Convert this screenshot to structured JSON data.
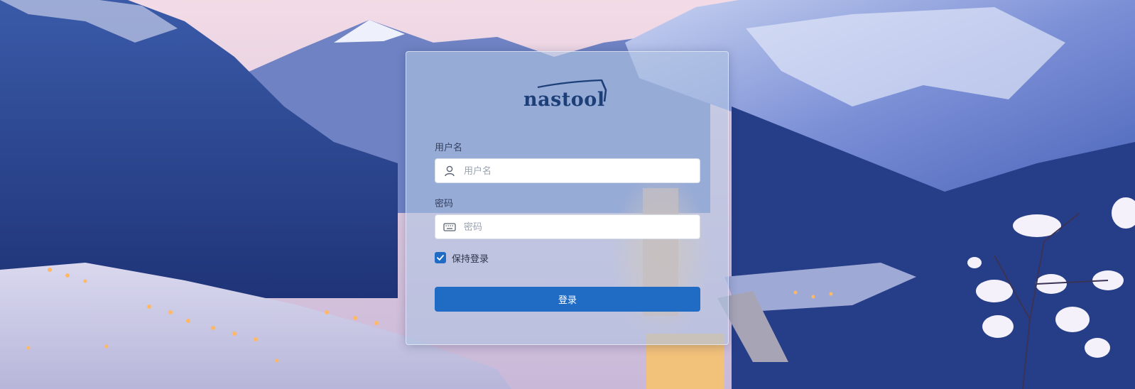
{
  "brand": {
    "logo_text": "nastool"
  },
  "form": {
    "username": {
      "label": "用户名",
      "placeholder": "用户名",
      "value": ""
    },
    "password": {
      "label": "密码",
      "placeholder": "密码",
      "value": ""
    },
    "remember": {
      "label": "保持登录",
      "checked": true
    },
    "submit_label": "登录"
  },
  "icons": {
    "username": "user-icon",
    "password": "keyboard-icon",
    "remember": "checkmark-icon"
  },
  "colors": {
    "primary": "#206bc4",
    "logo": "#1d3f78"
  }
}
